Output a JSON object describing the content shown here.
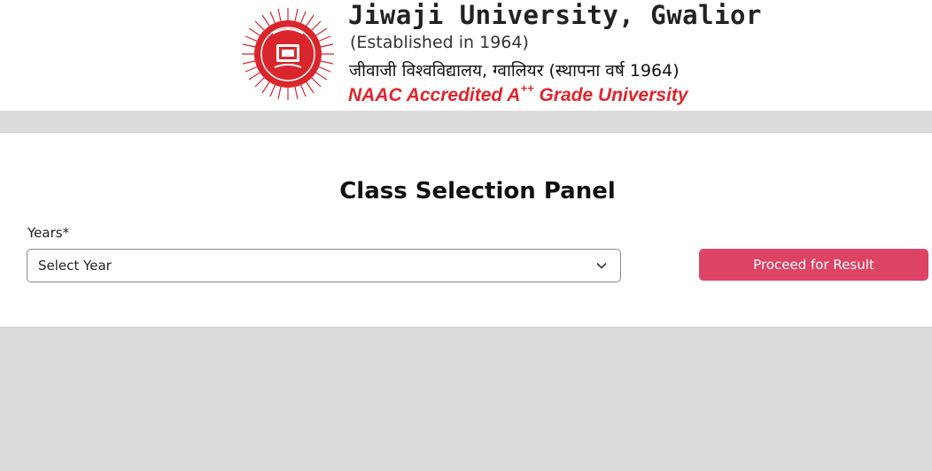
{
  "header": {
    "university_name": "Jiwaji University, Gwalior",
    "established": "(Established in 1964)",
    "hindi_name": "जीवाजी विश्वविद्यालय, ग्वालियर (स्थापना वर्ष 1964)",
    "naac_prefix": "NAAC Accredited A",
    "naac_sup": "++",
    "naac_suffix": " Grade University",
    "logo_icon": "university-seal-icon"
  },
  "panel": {
    "title": "Class Selection Panel",
    "years_label": "Years*",
    "select_value": "Select Year",
    "proceed_label": "Proceed for Result"
  },
  "colors": {
    "accent": "#dd4365",
    "naac_red": "#e0262b",
    "background": "#dcdcdc"
  }
}
